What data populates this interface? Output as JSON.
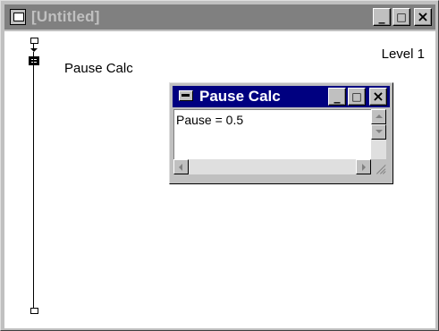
{
  "outer_window": {
    "title": "[Untitled]",
    "minimize_glyph": "_",
    "maximize_glyph": "□",
    "close_glyph": "×"
  },
  "flowline": {
    "icon_label": "Pause Calc",
    "level_label": "Level 1"
  },
  "pause_calc_window": {
    "title": "Pause Calc",
    "minimize_glyph": "_",
    "maximize_glyph": "□",
    "close_glyph": "×",
    "content_text": "Pause = 0.5"
  },
  "colors": {
    "inactive_titlebar": "#808080",
    "active_titlebar": "#000080",
    "window_face": "#c0c0c0"
  }
}
